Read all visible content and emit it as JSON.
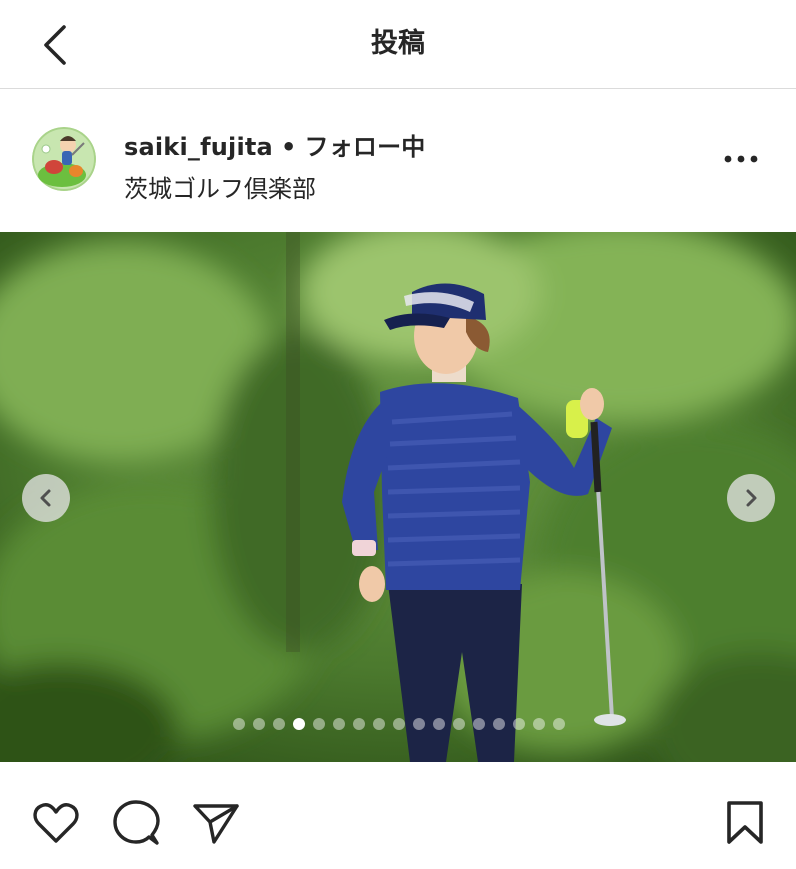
{
  "header": {
    "title": "投稿",
    "back_icon": "chevron-left-icon"
  },
  "post": {
    "username": "saiki_fujita",
    "separator": "•",
    "follow_status": "フォロー中",
    "location": "茨城ゴルフ倶楽部",
    "more_icon": "more-horizontal-icon"
  },
  "carousel": {
    "total": 17,
    "current": 4,
    "prev_icon": "chevron-left-icon",
    "next_icon": "chevron-right-icon"
  },
  "actions": {
    "like_icon": "heart-icon",
    "comment_icon": "comment-icon",
    "share_icon": "send-icon",
    "save_icon": "bookmark-icon"
  },
  "colors": {
    "text": "#262626",
    "divider": "#dbdbdb",
    "background": "#ffffff"
  }
}
